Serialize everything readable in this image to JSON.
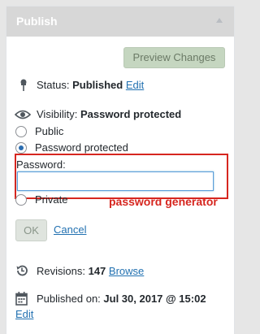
{
  "panel": {
    "title": "Publish",
    "preview_label": "Preview Changes"
  },
  "status": {
    "label": "Status:",
    "value": "Published",
    "edit_link": "Edit"
  },
  "visibility": {
    "label": "Visibility:",
    "value": "Password protected",
    "options": [
      {
        "label": "Public",
        "checked": false
      },
      {
        "label": "Password protected",
        "checked": true
      },
      {
        "label": "Private",
        "checked": false
      }
    ],
    "password_label": "Password:",
    "password_value": "",
    "ok_label": "OK",
    "cancel_label": "Cancel"
  },
  "annotation": {
    "text": "password generator",
    "color": "#d6261f"
  },
  "revisions": {
    "label": "Revisions:",
    "count": "147",
    "browse_link": "Browse"
  },
  "published": {
    "label": "Published on:",
    "value": "Jul 30, 2017 @ 15:02",
    "edit_link": "Edit"
  },
  "icons": [
    "pin-icon",
    "eye-icon",
    "history-icon",
    "calendar-icon"
  ],
  "colors": {
    "link": "#2271b1",
    "header_bg": "#d7d7d7",
    "highlight": "#d6261f"
  }
}
